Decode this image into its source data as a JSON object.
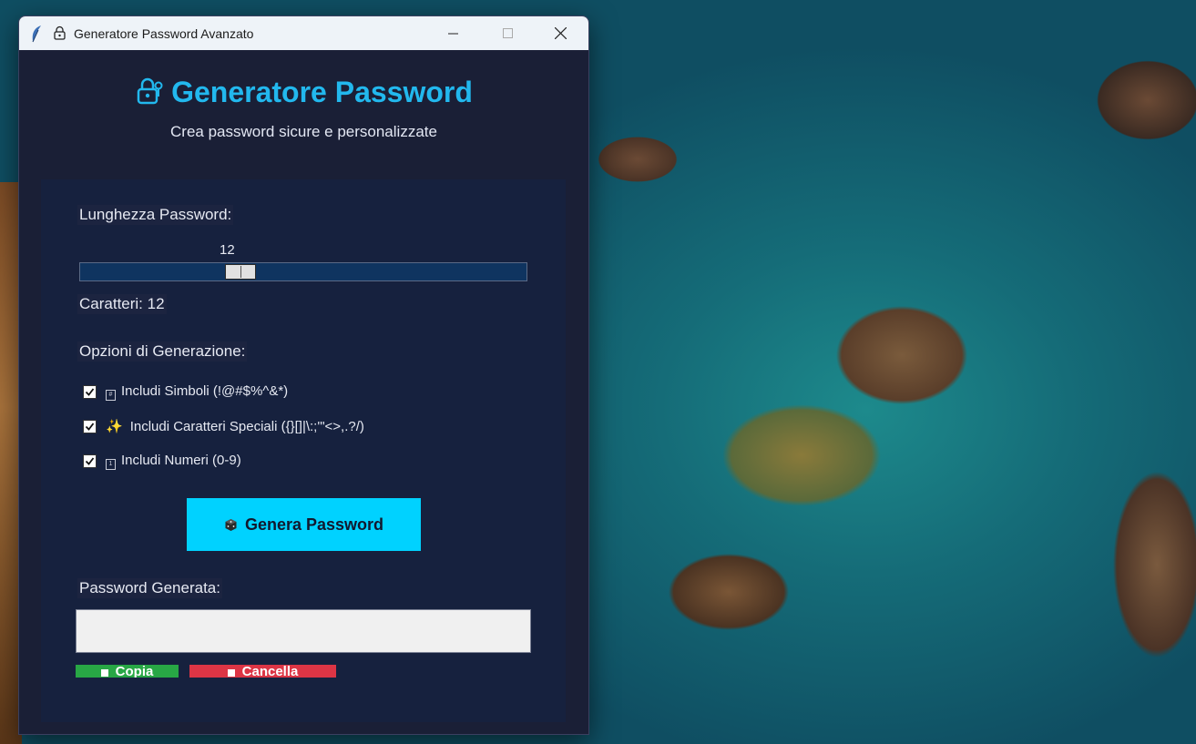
{
  "window": {
    "title": "Generatore Password Avanzato"
  },
  "header": {
    "title": "Generatore Password",
    "subtitle": "Crea password sicure e personalizzate"
  },
  "length": {
    "label": "Lunghezza Password:",
    "slider_value": "12",
    "slider_fraction": 0.35,
    "count_label": "Caratteri: 12"
  },
  "options": {
    "label": "Opzioni di Generazione:",
    "items": [
      {
        "label": "Includi Simboli (!@#$%^&*)",
        "checked": true,
        "icon": "keycap-icon"
      },
      {
        "label": "Includi Caratteri Speciali ({}[]|\\:;'\"<>,.?/)",
        "checked": true,
        "icon": "sparkles-icon"
      },
      {
        "label": "Includi Numeri (0-9)",
        "checked": true,
        "icon": "keycap-icon"
      }
    ]
  },
  "generate_button": {
    "label": "Genera Password",
    "icon": "dice-icon"
  },
  "output": {
    "label": "Password Generata:",
    "value": ""
  },
  "actions": {
    "copy_label": "Copia",
    "cancel_label": "Cancella"
  },
  "colors": {
    "accent": "#00d2ff",
    "title": "#22b8ee",
    "copy": "#28a745",
    "cancel": "#dc3545",
    "panel": "#16213e"
  }
}
